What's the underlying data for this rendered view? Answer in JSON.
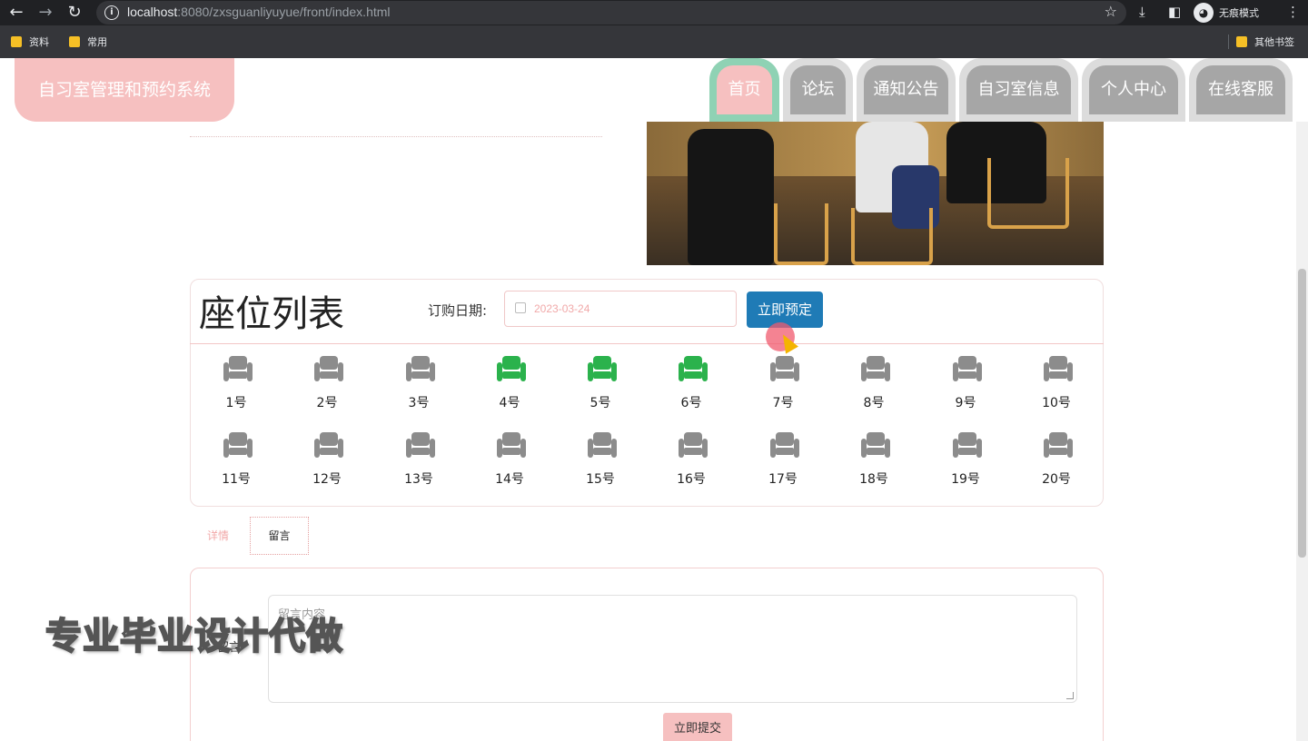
{
  "browser": {
    "url_host": "localhost",
    "url_rest": ":8080/zxsguanliyuyue/front/index.html",
    "incognito_label": "无痕模式",
    "bookmarks": [
      "资料",
      "常用"
    ],
    "other_bookmarks": "其他书签"
  },
  "site": {
    "logo": "自习室管理和预约系统",
    "nav": [
      {
        "label": "首页",
        "active": true
      },
      {
        "label": "论坛",
        "active": false
      },
      {
        "label": "通知公告",
        "active": false
      },
      {
        "label": "自习室信息",
        "active": false
      },
      {
        "label": "个人中心",
        "active": false
      },
      {
        "label": "在线客服",
        "active": false
      }
    ]
  },
  "seats": {
    "title": "座位列表",
    "date_label": "订购日期:",
    "date_value": "2023-03-24",
    "book_button": "立即预定",
    "items": [
      {
        "label": "1号",
        "status": "available"
      },
      {
        "label": "2号",
        "status": "available"
      },
      {
        "label": "3号",
        "status": "available"
      },
      {
        "label": "4号",
        "status": "selected"
      },
      {
        "label": "5号",
        "status": "selected"
      },
      {
        "label": "6号",
        "status": "selected"
      },
      {
        "label": "7号",
        "status": "available"
      },
      {
        "label": "8号",
        "status": "available"
      },
      {
        "label": "9号",
        "status": "available"
      },
      {
        "label": "10号",
        "status": "available"
      },
      {
        "label": "11号",
        "status": "available"
      },
      {
        "label": "12号",
        "status": "available"
      },
      {
        "label": "13号",
        "status": "available"
      },
      {
        "label": "14号",
        "status": "available"
      },
      {
        "label": "15号",
        "status": "available"
      },
      {
        "label": "16号",
        "status": "available"
      },
      {
        "label": "17号",
        "status": "available"
      },
      {
        "label": "18号",
        "status": "available"
      },
      {
        "label": "19号",
        "status": "available"
      },
      {
        "label": "20号",
        "status": "available"
      }
    ]
  },
  "tabs": {
    "detail": "详情",
    "message": "留言"
  },
  "message_form": {
    "label": "留言",
    "placeholder": "留言内容",
    "submit": "立即提交"
  },
  "watermark": "专业毕业设计代做",
  "colors": {
    "accent_pink": "#f6c0c0",
    "active_green": "#8fd2b4",
    "seat_available": "#8c8c8c",
    "seat_selected": "#2bb24c",
    "book_button": "#1f7bb6"
  }
}
